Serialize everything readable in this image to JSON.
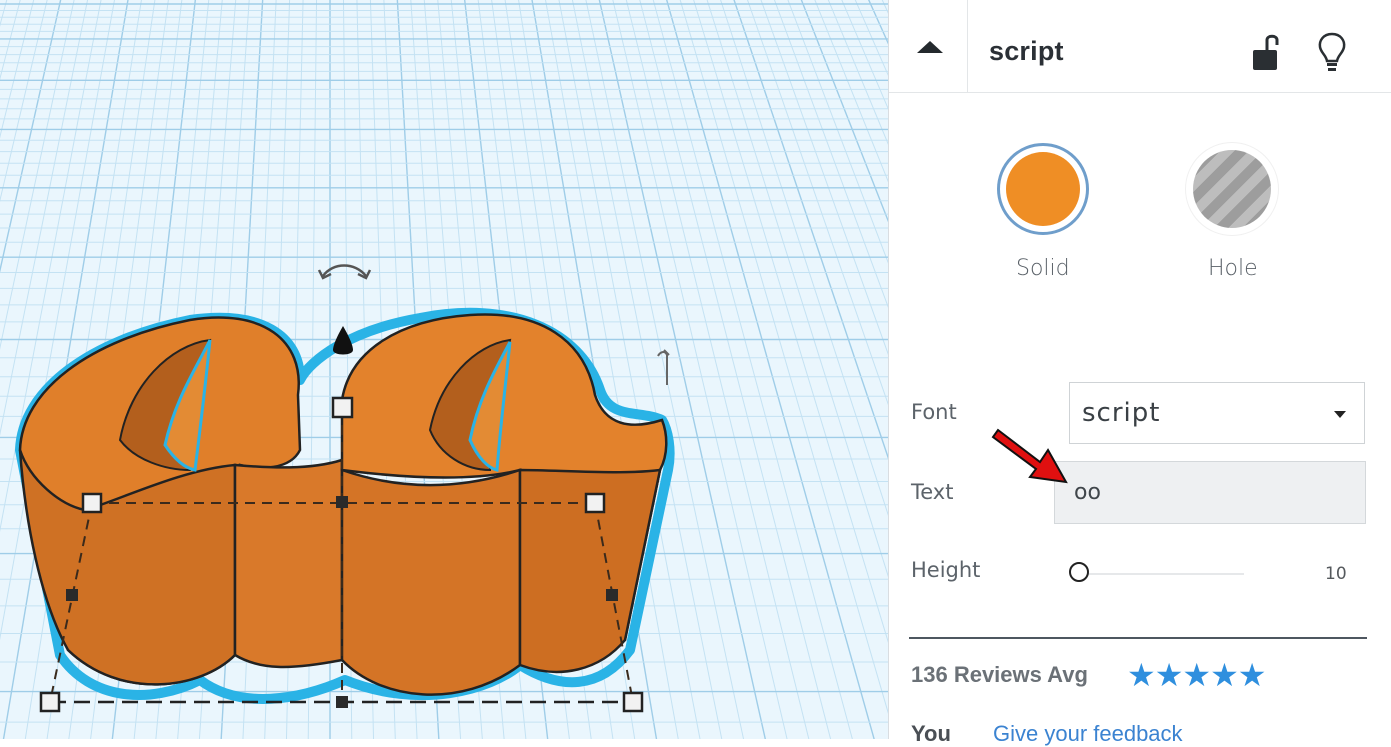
{
  "panel": {
    "title": "script",
    "colors": {
      "solid": "#ef8e25",
      "hole_stripe_light": "#bdbdbd",
      "hole_stripe_dark": "#9d9d9d",
      "selection_outline": "#2ab3e6"
    },
    "solid_label": "Solid",
    "hole_label": "Hole",
    "font_label": "Font",
    "font_value": "script",
    "text_label": "Text",
    "text_value": "oo",
    "height_label": "Height",
    "height_value": "10",
    "reviews_label": "136 Reviews Avg",
    "stars": "★★★★★",
    "you_label": "You",
    "feedback_link": "Give your feedback"
  },
  "icons": {
    "collapse": "caret-up-icon",
    "lock": "unlocked-padlock-icon",
    "bulb": "lightbulb-icon",
    "font_dropdown": "caret-down-icon",
    "rotate": "rotate-arrow-icon",
    "lift": "cone-lift-icon",
    "annotation": "red-arrow-icon"
  }
}
